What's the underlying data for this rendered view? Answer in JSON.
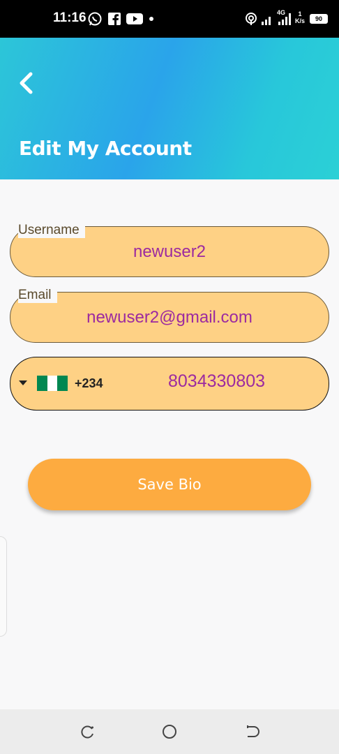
{
  "status_bar": {
    "time": "11:16",
    "network_type": "4G",
    "speed_value": "1",
    "speed_unit": "K/s",
    "battery": "90",
    "icons": [
      "whatsapp-icon",
      "facebook-icon",
      "youtube-icon",
      "notification-dot-icon",
      "hotspot-icon",
      "signal-icon",
      "signal-icon",
      "battery-icon"
    ]
  },
  "header": {
    "title": "Edit My Account",
    "back_icon": "chevron-left-icon",
    "colors": {
      "gradient_start": "#2cc6d8",
      "gradient_mid": "#2aa4ea",
      "gradient_end": "#2bd0d6"
    }
  },
  "form": {
    "username": {
      "label": "Username",
      "value": "newuser2"
    },
    "email": {
      "label": "Email",
      "value": "newuser2@gmail.com"
    },
    "phone": {
      "country_flag": "nigeria-flag-icon",
      "dial_code": "+234",
      "value": "8034330803"
    },
    "colors": {
      "field_fill": "#fed185",
      "value_text": "#9c2aa0"
    }
  },
  "actions": {
    "save_label": "Save Bio",
    "colors": {
      "button": "#fdab40"
    }
  },
  "nav_bar": {
    "icons": [
      "recent-apps-icon",
      "home-icon",
      "back-icon"
    ]
  }
}
